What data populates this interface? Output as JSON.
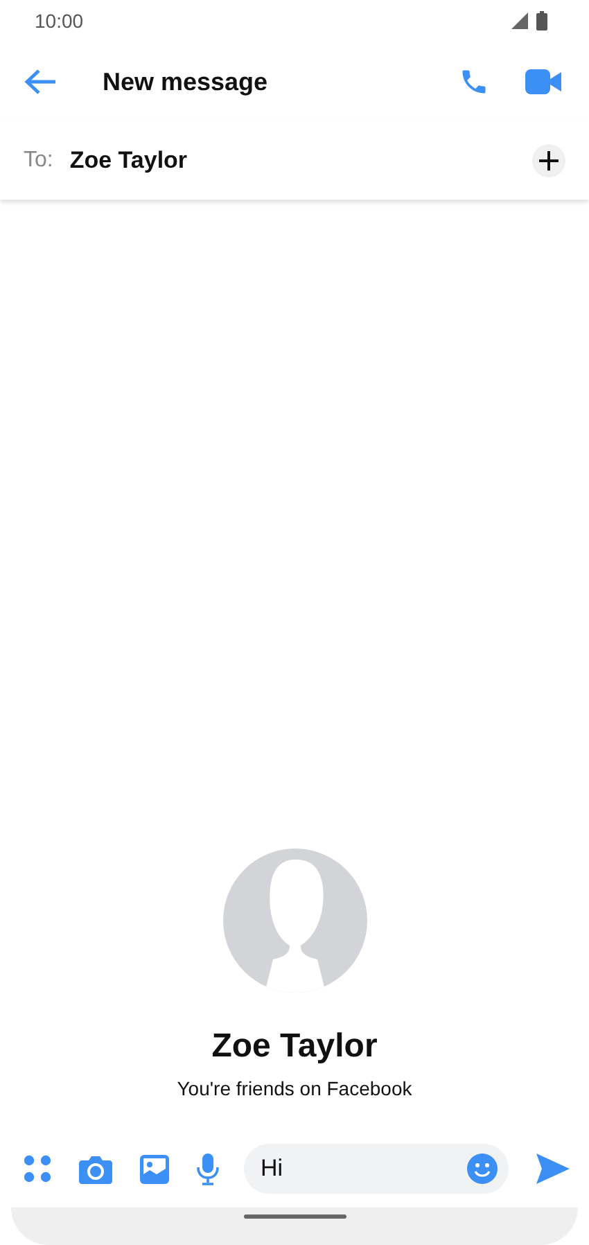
{
  "status_bar": {
    "time": "10:00"
  },
  "header": {
    "title": "New message"
  },
  "recipient_row": {
    "label": "To:",
    "recipient": "Zoe Taylor"
  },
  "profile": {
    "name": "Zoe Taylor",
    "subtitle": "You're friends on Facebook"
  },
  "composer": {
    "value": "Hi"
  }
}
